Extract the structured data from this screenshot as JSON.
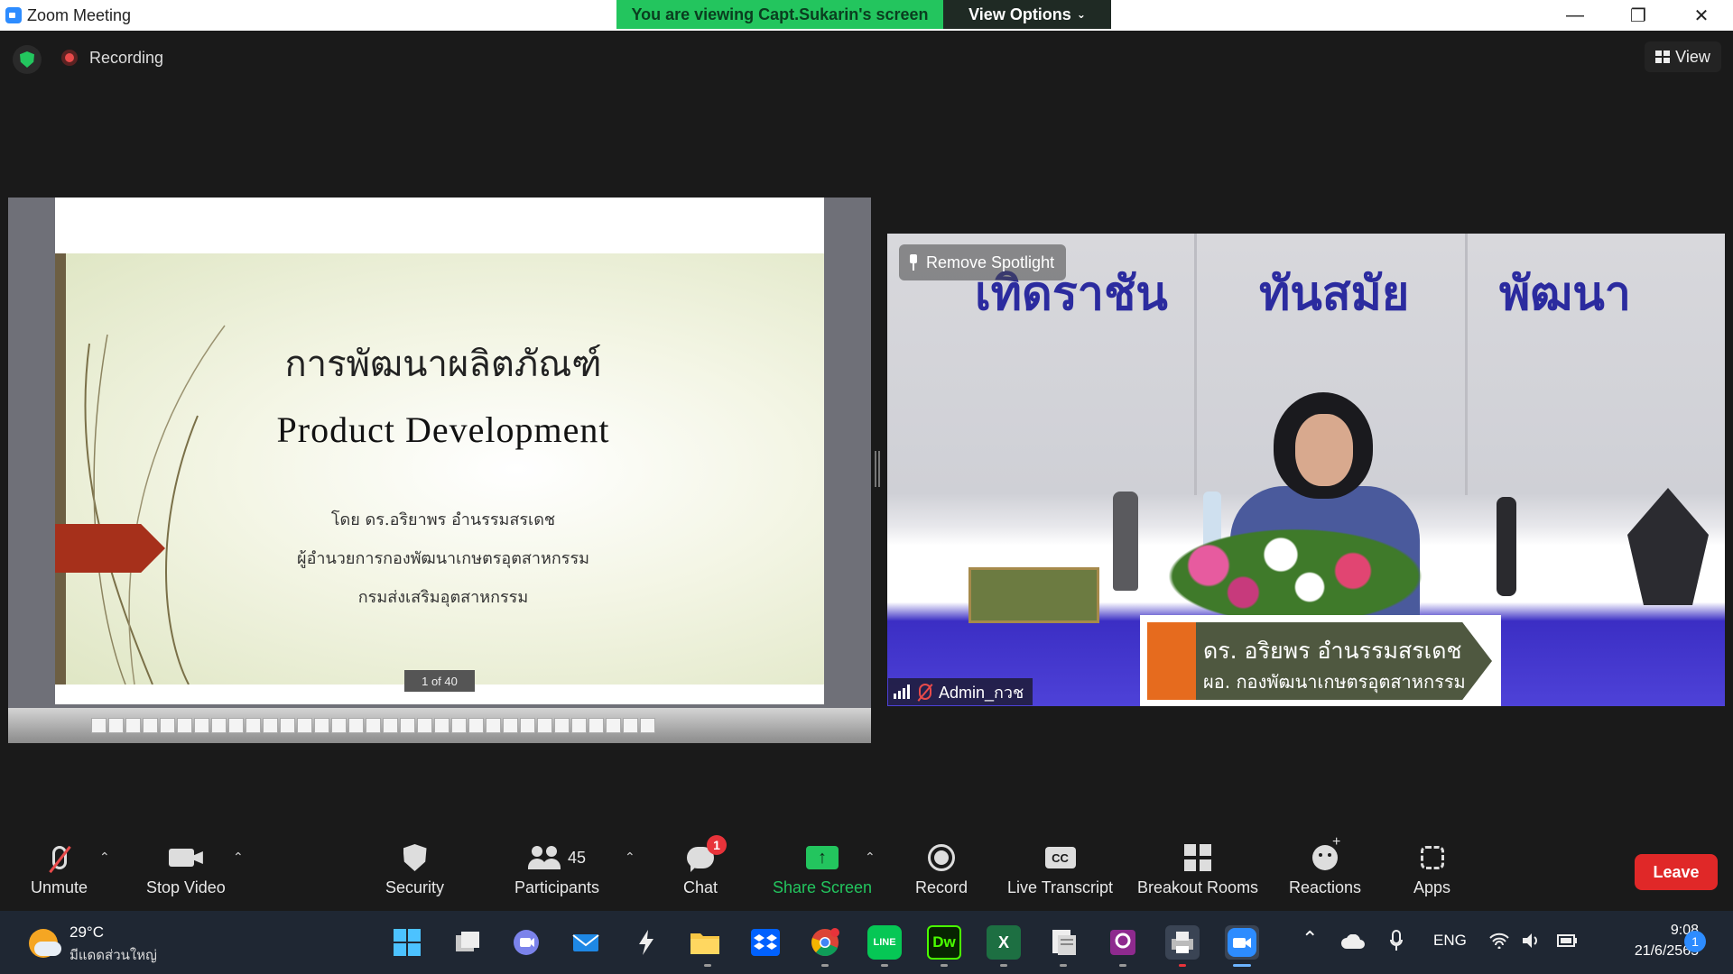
{
  "window": {
    "title": "Zoom Meeting",
    "viewing_banner": "You are viewing Capt.Sukarin's screen",
    "view_options": "View Options",
    "minimize": "—",
    "maximize": "❐",
    "close": "✕"
  },
  "meeting_header": {
    "recording_label": "Recording",
    "view_label": "View"
  },
  "slide": {
    "title_th": "การพัฒนาผลิตภัณฑ์",
    "title_en": "Product Development",
    "author": "โดย ดร.อริยาพร อำนรรมสรเดช",
    "position": "ผู้อำนวยการกองพัฒนาเกษตรอุตสาหกรรม",
    "department": "กรมส่งเสริมอุตสาหกรรม",
    "counter": "1 of 40"
  },
  "video": {
    "banner_words": [
      "เทิดราชัน",
      "ทันสมัย",
      "พัฒนา"
    ],
    "nameplate_line1": "ดร. อริยพร อำนรรมสรเดช",
    "nameplate_line2": "ผอ. กองพัฒนาเกษตรอุตสาหกรรม",
    "remove_spotlight": "Remove Spotlight",
    "participant_name": "Admin_กวช"
  },
  "toolbar": {
    "unmute": "Unmute",
    "stop_video": "Stop Video",
    "security": "Security",
    "participants": "Participants",
    "participants_count": "45",
    "chat": "Chat",
    "chat_badge": "1",
    "share_screen": "Share Screen",
    "record": "Record",
    "live_transcript": "Live Transcript",
    "cc_text": "CC",
    "breakout_rooms": "Breakout Rooms",
    "reactions": "Reactions",
    "apps": "Apps",
    "leave": "Leave"
  },
  "taskbar": {
    "weather_temp": "29°C",
    "weather_desc": "มีแดดส่วนใหญ่",
    "excel_letter": "X",
    "dw_label": "Dw",
    "line_label": "LINE",
    "language": "ENG",
    "time": "9:08",
    "date": "21/6/2565",
    "notification_count": "1"
  },
  "colors": {
    "accent_green": "#23c55e",
    "leave_red": "#e02828",
    "zoom_blue": "#2d8cff"
  }
}
